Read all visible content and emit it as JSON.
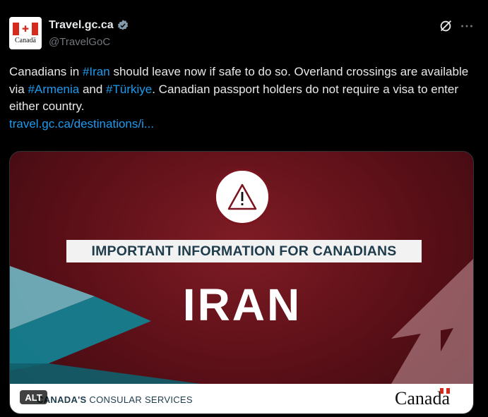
{
  "account": {
    "display_name": "Travel.gc.ca",
    "handle": "@TravelGoC",
    "avatar_wordmark": "Canadä"
  },
  "tweet": {
    "part1": "Canadians in ",
    "tag1": "#Iran",
    "part2": " should leave now if safe to do so. Overland crossings are available via ",
    "tag2": "#Armenia",
    "part3": " and ",
    "tag3": "#Türkiye",
    "part4": ". Canadian passport holders do not require a visa to enter either country.",
    "link": "travel.gc.ca/destinations/i..."
  },
  "card": {
    "banner": "IMPORTANT INFORMATION FOR CANADIANS",
    "country": "IRAN",
    "footer_bold": "CANADA'S",
    "footer_rest": " CONSULAR SERVICES",
    "wordmark": "Canada",
    "alt_label": "ALT"
  },
  "icons": {
    "verified": "verified-badge-icon",
    "grok": "grok-icon",
    "more": "more-icon",
    "warning": "warning-icon"
  },
  "colors": {
    "link": "#1d9bf0",
    "background": "#000000",
    "card_red": "#7f1c25",
    "banner_text": "#1f3c4c"
  }
}
